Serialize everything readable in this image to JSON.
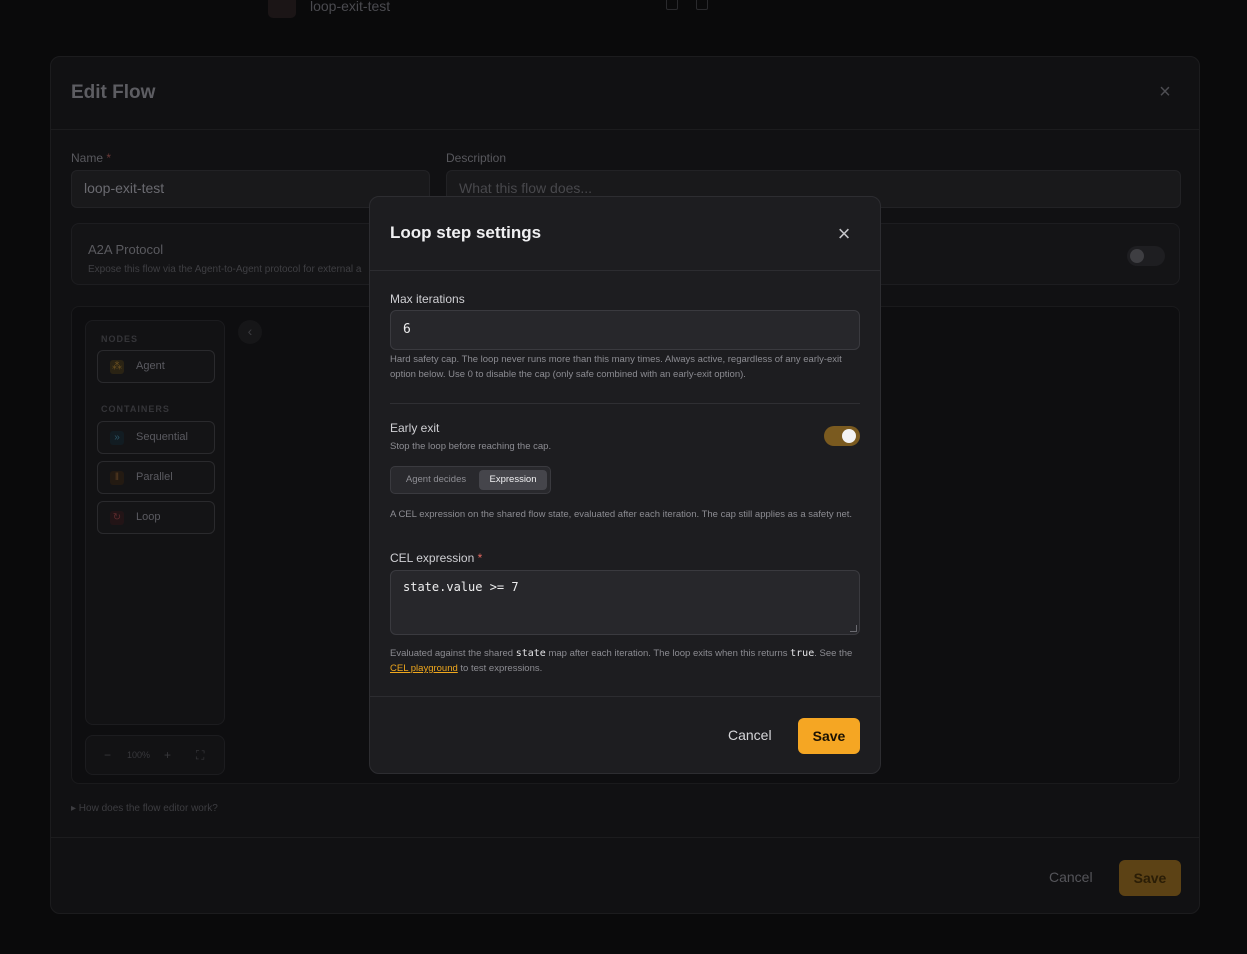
{
  "background": {
    "flow_title": "loop-exit-test"
  },
  "edit_flow": {
    "title": "Edit Flow",
    "name_label": "Name",
    "name_required_mark": "*",
    "name_value": "loop-exit-test",
    "description_label": "Description",
    "description_placeholder": "What this flow does...",
    "a2a_title": "A2A Protocol",
    "a2a_description": "Expose this flow via the Agent-to-Agent protocol for external a",
    "palette": {
      "nodes_heading": "NODES",
      "containers_heading": "CONTAINERS",
      "items": [
        {
          "label": "Agent",
          "icon": "agent-icon"
        },
        {
          "label": "Sequential",
          "icon": "sequential-icon"
        },
        {
          "label": "Parallel",
          "icon": "parallel-icon"
        },
        {
          "label": "Loop",
          "icon": "loop-icon"
        }
      ]
    },
    "zoom": {
      "minus": "−",
      "level": "100%",
      "plus": "+",
      "fit": "⛶"
    },
    "help_link": "▸ How does the flow editor work?",
    "cancel_label": "Cancel",
    "save_label": "Save"
  },
  "loop_modal": {
    "title": "Loop step settings",
    "max_iterations_label": "Max iterations",
    "max_iterations_value": "6",
    "max_iterations_help": "Hard safety cap. The loop never runs more than this many times. Always active, regardless of any early-exit option below. Use 0 to disable the cap (only safe combined with an early-exit option).",
    "early_exit_label": "Early exit",
    "early_exit_help": "Stop the loop before reaching the cap.",
    "early_exit_enabled": true,
    "mode_options": [
      "Agent decides",
      "Expression"
    ],
    "mode_selected": "Expression",
    "expression_help": "A CEL expression on the shared flow state, evaluated after each iteration. The cap still applies as a safety net.",
    "cel_label": "CEL expression",
    "cel_required_mark": "*",
    "cel_value": "state.value >= 7",
    "cel_help_pre": "Evaluated against the shared ",
    "cel_help_code1": "state",
    "cel_help_mid": " map after each iteration. The loop exits when this returns ",
    "cel_help_code2": "true",
    "cel_help_mid2": ". See the ",
    "cel_help_link": "CEL playground",
    "cel_help_post": " to test expressions.",
    "cancel_label": "Cancel",
    "save_label": "Save",
    "accent_color": "#f5a623"
  }
}
